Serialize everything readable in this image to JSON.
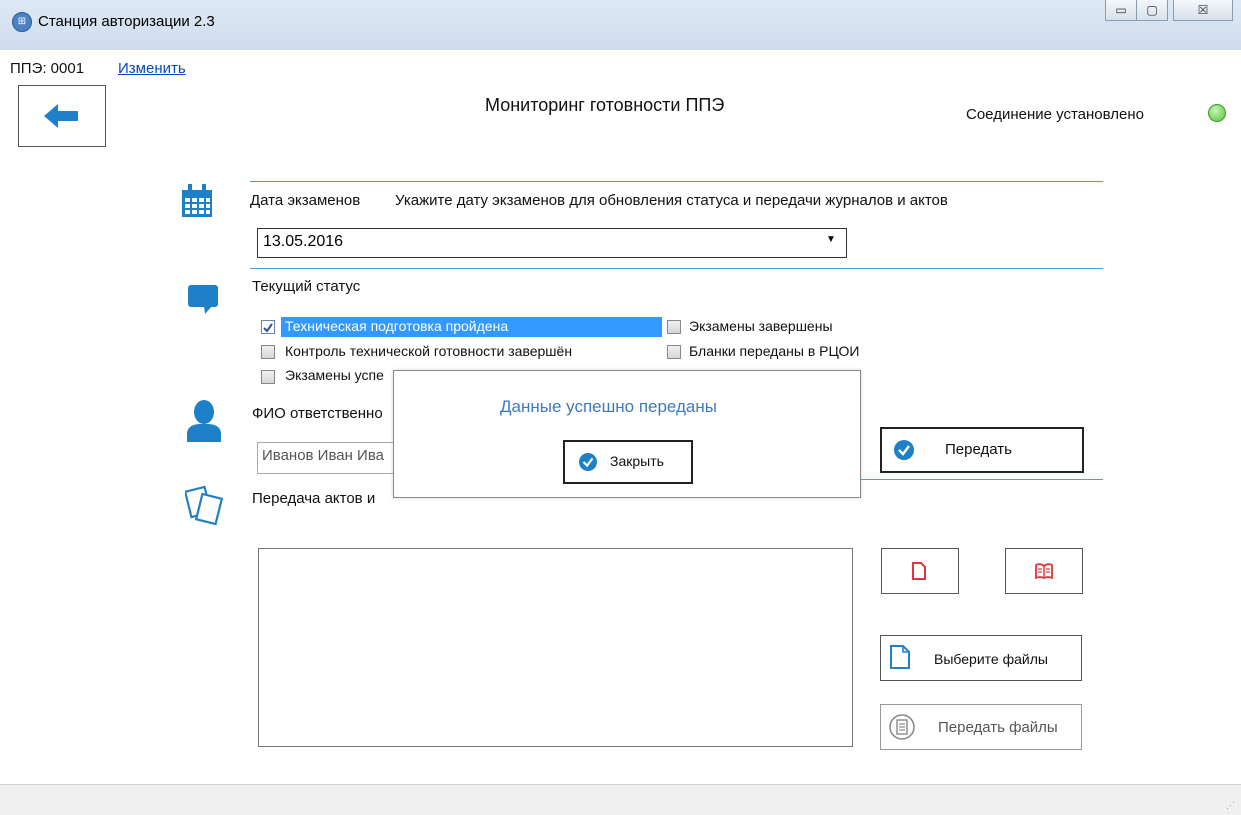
{
  "window": {
    "title": "Станция авторизации 2.3",
    "controls": [
      "minimize",
      "maximize",
      "close"
    ],
    "close_glyph": "☒"
  },
  "ppe": {
    "label": "ППЭ: 0001",
    "change_link": "Изменить"
  },
  "header": {
    "title": "Мониторинг готовности ППЭ",
    "connection_status": "Соединение установлено",
    "connection_color": "#54c23a"
  },
  "exam_date": {
    "label": "Дата экзаменов",
    "hint": "Укажите дату экзаменов для обновления статуса и передачи журналов и актов",
    "value": "13.05.2016"
  },
  "status": {
    "label": "Текущий статус",
    "items": [
      {
        "label": "Техническая подготовка пройдена",
        "checked": true
      },
      {
        "label": "Контроль технической готовности завершён",
        "checked": false
      },
      {
        "label": "Экзамены успе",
        "checked": false
      },
      {
        "label": "Экзамены завершены",
        "checked": false
      },
      {
        "label": "Бланки переданы в РЦОИ",
        "checked": false
      }
    ]
  },
  "responsible": {
    "label": "ФИО ответственно",
    "value": "Иванов Иван Ива"
  },
  "send_button": "Передать",
  "acts": {
    "label": "Передача актов и ",
    "choose_files": "Выберите файлы",
    "send_files": "Передать файлы"
  },
  "dialog": {
    "message": "Данные успешно переданы",
    "close_button": "Закрыть"
  },
  "colors": {
    "accent": "#3c7bc2",
    "icon_blue": "#1e80c8",
    "selection": "#3399ff",
    "doc_red": "#e5323b"
  }
}
